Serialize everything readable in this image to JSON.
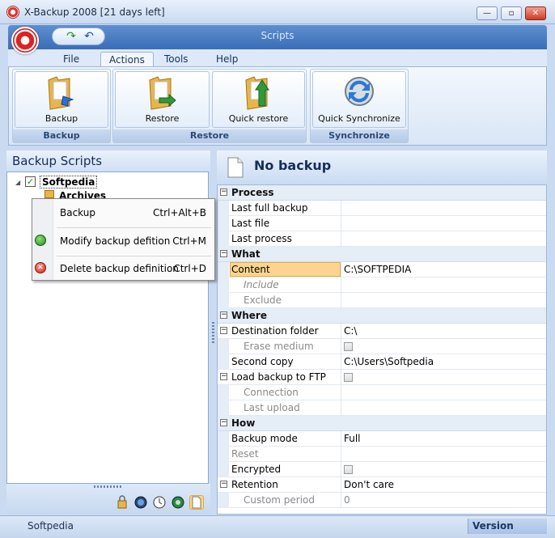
{
  "window": {
    "title": "X-Backup 2008 [21 days left]",
    "ribbon_title": "Scripts"
  },
  "menu": {
    "tabs": [
      {
        "label": "File"
      },
      {
        "label": "Actions"
      },
      {
        "label": "Tools"
      },
      {
        "label": "Help"
      }
    ],
    "active_tab": "Actions"
  },
  "ribbon": {
    "groups": [
      {
        "label": "Backup",
        "buttons": [
          {
            "label": "Backup",
            "icon": "folder-backup-icon"
          }
        ]
      },
      {
        "label": "Restore",
        "buttons": [
          {
            "label": "Restore",
            "icon": "folder-restore-icon"
          },
          {
            "label": "Quick restore",
            "icon": "folder-quick-restore-icon"
          }
        ]
      },
      {
        "label": "Synchronize",
        "buttons": [
          {
            "label": "Quick Synchronize",
            "icon": "sync-icon"
          }
        ]
      }
    ]
  },
  "left_panel": {
    "title": "Backup Scripts",
    "tree": [
      {
        "label": "Softpedia",
        "checked": true
      },
      {
        "label": "Archives"
      }
    ]
  },
  "context_menu": {
    "items": [
      {
        "label": "Backup",
        "shortcut": "Ctrl+Alt+B"
      },
      {
        "label": "Modify backup defition",
        "shortcut": "Ctrl+M",
        "icon": "green-check-icon"
      },
      {
        "label": "Delete backup definition",
        "shortcut": "Ctrl+D",
        "icon": "red-delete-icon"
      }
    ]
  },
  "right_panel": {
    "title": "No backup",
    "categories": [
      {
        "label": "Process",
        "rows": [
          {
            "name": "Last full backup",
            "value": ""
          },
          {
            "name": "Last file",
            "value": ""
          },
          {
            "name": "Last process",
            "value": ""
          }
        ]
      },
      {
        "label": "What",
        "rows": [
          {
            "name": "Content",
            "value": "C:\\SOFTPEDIA"
          },
          {
            "name": "Include",
            "value": ""
          },
          {
            "name": "Exclude",
            "value": ""
          }
        ]
      },
      {
        "label": "Where",
        "rows": [
          {
            "name": "Destination folder",
            "value": "C:\\"
          },
          {
            "name": "Erase medium",
            "value": ""
          },
          {
            "name": "Second copy",
            "value": "C:\\Users\\Softpedia"
          },
          {
            "name": "Load backup to FTP",
            "value": ""
          },
          {
            "name": "Connection",
            "value": ""
          },
          {
            "name": "Last upload",
            "value": ""
          }
        ]
      },
      {
        "label": "How",
        "rows": [
          {
            "name": "Backup mode",
            "value": "Full"
          },
          {
            "name": "Reset",
            "value": ""
          },
          {
            "name": "Encrypted",
            "value": ""
          },
          {
            "name": "Retention",
            "value": "Don't care"
          },
          {
            "name": "Custom period",
            "value": "0"
          }
        ]
      }
    ]
  },
  "status_bar": {
    "left": "Softpedia",
    "right": "Version"
  },
  "colors": {
    "accent": "#3a6db7",
    "selection": "#fbd590"
  }
}
